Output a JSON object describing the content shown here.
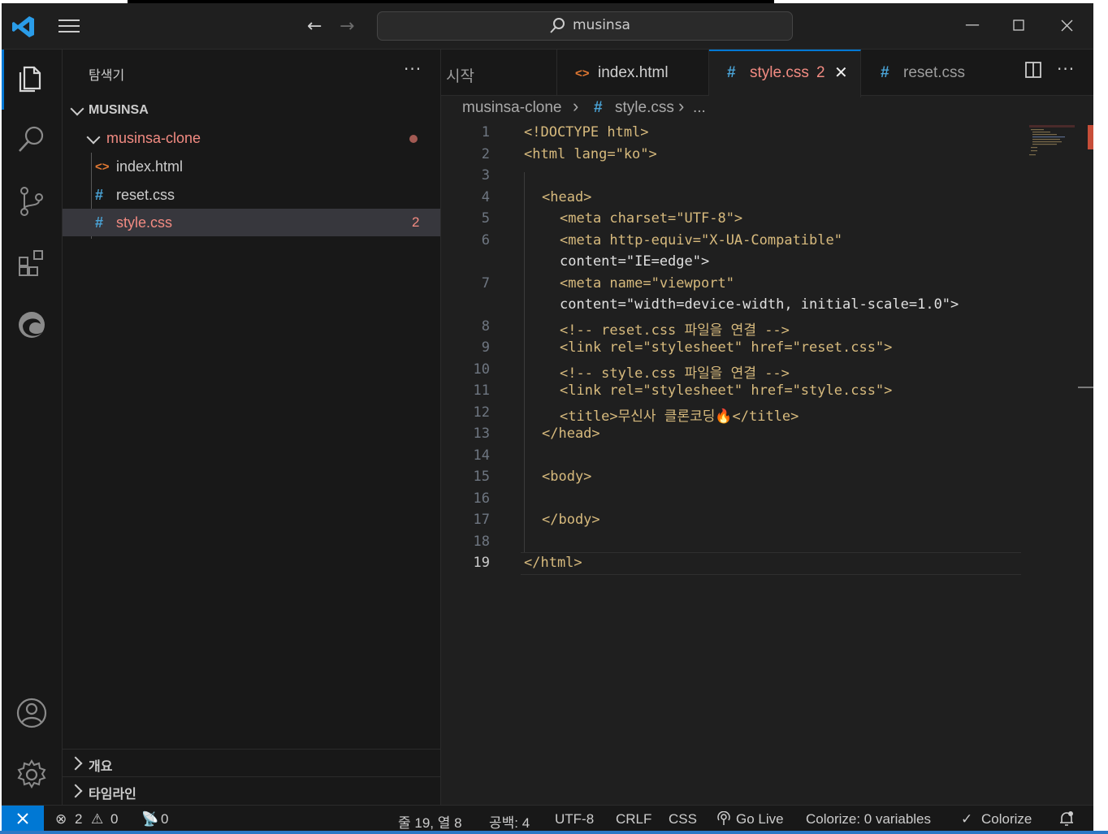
{
  "titlebar": {
    "search_text": "musinsa"
  },
  "sidebar": {
    "title": "탐색기",
    "more": "···",
    "workspace": "MUSINSA",
    "folder": "musinsa-clone",
    "files": [
      {
        "name": "index.html",
        "icon": "<>"
      },
      {
        "name": "reset.css",
        "icon": "#"
      },
      {
        "name": "style.css",
        "icon": "#",
        "problems": "2"
      }
    ],
    "sections": [
      "개요",
      "타임라인"
    ]
  },
  "tabs": [
    {
      "label": "시작"
    },
    {
      "icon": "<>",
      "label": "index.html"
    },
    {
      "icon": "#",
      "label": "style.css",
      "problems": "2",
      "close": "✕"
    },
    {
      "icon": "#",
      "label": "reset.css"
    }
  ],
  "breadcrumb": {
    "folder": "musinsa-clone",
    "sep": "›",
    "file_icon": "#",
    "file": "style.css",
    "ellipsis": "..."
  },
  "editor": {
    "line_numbers": [
      "1",
      "2",
      "3",
      "4",
      "5",
      "6",
      "7",
      "8",
      "9",
      "10",
      "11",
      "12",
      "13",
      "14",
      "15",
      "16",
      "17",
      "18",
      "19"
    ],
    "lines": [
      "<!DOCTYPE html>",
      "<html lang=\"ko\">",
      "",
      "<head>",
      "<meta charset=\"UTF-8\">",
      "<meta http-equiv=\"X-UA-Compatible\"",
      "content=\"IE=edge\">",
      "<meta name=\"viewport\"",
      "content=\"width=device-width, initial-scale=1.0\">",
      "<!-- reset.css 파일을 연결 -->",
      "<link rel=\"stylesheet\" href=\"reset.css\">",
      "<!-- style.css 파일을 연결 -->",
      "<link rel=\"stylesheet\" href=\"style.css\">",
      "<title>무신사 클론코딩🔥</title>",
      "</head>",
      "<body>",
      "</body>",
      "</html>"
    ]
  },
  "status": {
    "errors": "2",
    "warnings": "0",
    "ports": "0",
    "position": "줄 19, 열 8",
    "spaces": "공백: 4",
    "encoding": "UTF-8",
    "eol": "CRLF",
    "language": "CSS",
    "golive": "Go Live",
    "colorize_vars": "Colorize: 0 variables",
    "colorize": "Colorize"
  },
  "colors": {
    "accent": "#0078d4",
    "error_text": "#f28b82",
    "tag": "#d7ba7d",
    "attribute_blue": "#4ea8e0"
  }
}
